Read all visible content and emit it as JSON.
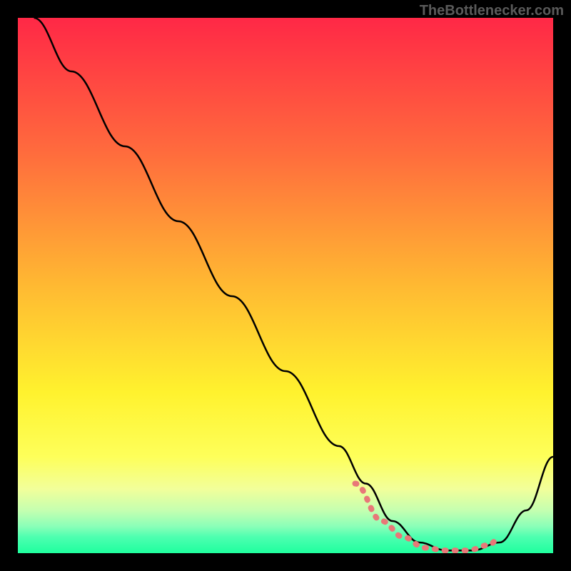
{
  "watermark": "TheBottlenecker.com",
  "chart_data": {
    "type": "line",
    "title": "",
    "xlabel": "",
    "ylabel": "",
    "xlim": [
      0,
      100
    ],
    "ylim": [
      0,
      100
    ],
    "gradient_stops": [
      {
        "offset": 0,
        "color": "#ff2846"
      },
      {
        "offset": 25,
        "color": "#ff6b3d"
      },
      {
        "offset": 50,
        "color": "#ffb932"
      },
      {
        "offset": 70,
        "color": "#fff22e"
      },
      {
        "offset": 82,
        "color": "#feff5a"
      },
      {
        "offset": 88,
        "color": "#f2ff9a"
      },
      {
        "offset": 92,
        "color": "#c5ffb0"
      },
      {
        "offset": 95,
        "color": "#8affb8"
      },
      {
        "offset": 97,
        "color": "#4dffb0"
      },
      {
        "offset": 100,
        "color": "#1fff9e"
      }
    ],
    "series": [
      {
        "name": "bottleneck-curve",
        "color": "#000000",
        "x": [
          3,
          10,
          20,
          30,
          40,
          50,
          60,
          65,
          70,
          75,
          80,
          85,
          90,
          95,
          100
        ],
        "y": [
          100,
          90,
          76,
          62,
          48,
          34,
          20,
          13,
          6,
          2,
          0.5,
          0.5,
          2,
          8,
          18
        ]
      },
      {
        "name": "optimal-zone-highlight",
        "color": "#e87878",
        "stroke_width": 8,
        "x": [
          63,
          68,
          72,
          76,
          80,
          84,
          88,
          90
        ],
        "y": [
          13,
          6,
          3,
          1,
          0.5,
          0.5,
          1.5,
          3
        ]
      }
    ]
  }
}
